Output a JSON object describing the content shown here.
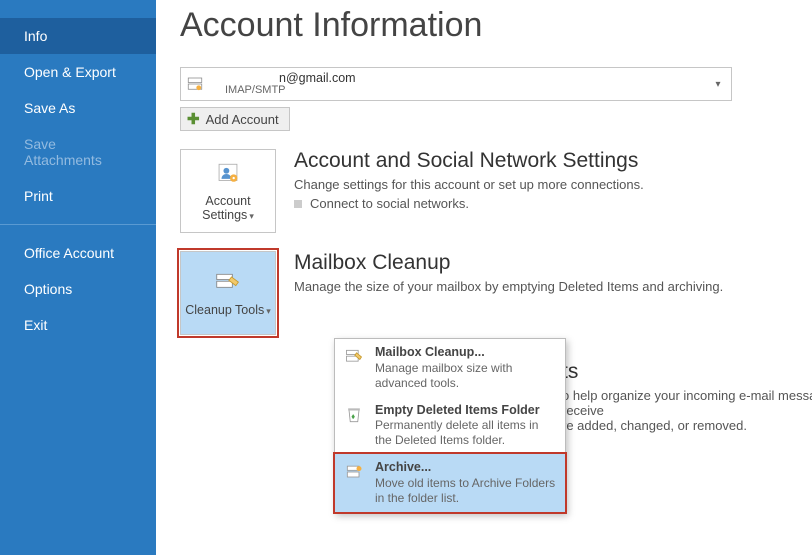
{
  "sidebar": {
    "items": [
      {
        "label": "Info",
        "state": "active"
      },
      {
        "label": "Open & Export",
        "state": ""
      },
      {
        "label": "Save As",
        "state": ""
      },
      {
        "label": "Save Attachments",
        "state": "disabled"
      },
      {
        "label": "Print",
        "state": ""
      },
      {
        "label": "Office Account",
        "state": ""
      },
      {
        "label": "Options",
        "state": ""
      },
      {
        "label": "Exit",
        "state": ""
      }
    ]
  },
  "page": {
    "title": "Account Information"
  },
  "account": {
    "email": "n@gmail.com",
    "protocol": "IMAP/SMTP"
  },
  "add_account_label": "Add Account",
  "settings_card": {
    "button": "Account Settings",
    "heading": "Account and Social Network Settings",
    "desc": "Change settings for this account or set up more connections.",
    "bullet": "Connect to social networks."
  },
  "cleanup_card": {
    "button": "Cleanup Tools",
    "heading": "Mailbox Cleanup",
    "desc": "Manage the size of your mailbox by emptying Deleted Items and archiving."
  },
  "rules_trunc": {
    "heading_tail": "ts",
    "desc_tail": "o help organize your incoming e-mail messages, and receive",
    "desc_tail2": "re added, changed, or removed."
  },
  "menu": {
    "items": [
      {
        "title": "Mailbox Cleanup...",
        "desc": "Manage mailbox size with advanced tools."
      },
      {
        "title": "Empty Deleted Items Folder",
        "desc": "Permanently delete all items in the Deleted Items folder."
      },
      {
        "title": "Archive...",
        "desc": "Move old items to Archive Folders in the folder list."
      }
    ]
  }
}
